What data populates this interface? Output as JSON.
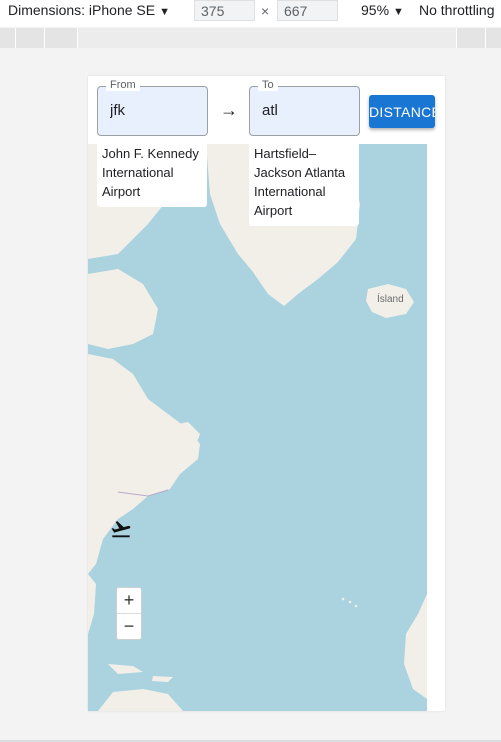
{
  "devtools": {
    "dimensions_label": "Dimensions: iPhone SE",
    "width": "375",
    "height": "667",
    "times_symbol": "×",
    "zoom": "95%",
    "throttle": "No throttling",
    "caret": "▼"
  },
  "app": {
    "from": {
      "legend": "From",
      "value": "jfk",
      "airport_name": "John F. Kennedy International Airport"
    },
    "to": {
      "legend": "To",
      "value": "atl",
      "airport_name": "Hartsfield–Jackson Atlanta International Airport"
    },
    "arrow": "→",
    "distance_button": "DISTANCE"
  },
  "map": {
    "label_iceland": "Ísland",
    "zoom_in": "+",
    "zoom_out": "−",
    "colors": {
      "water": "#aad3df",
      "land": "#f2efe9"
    }
  }
}
